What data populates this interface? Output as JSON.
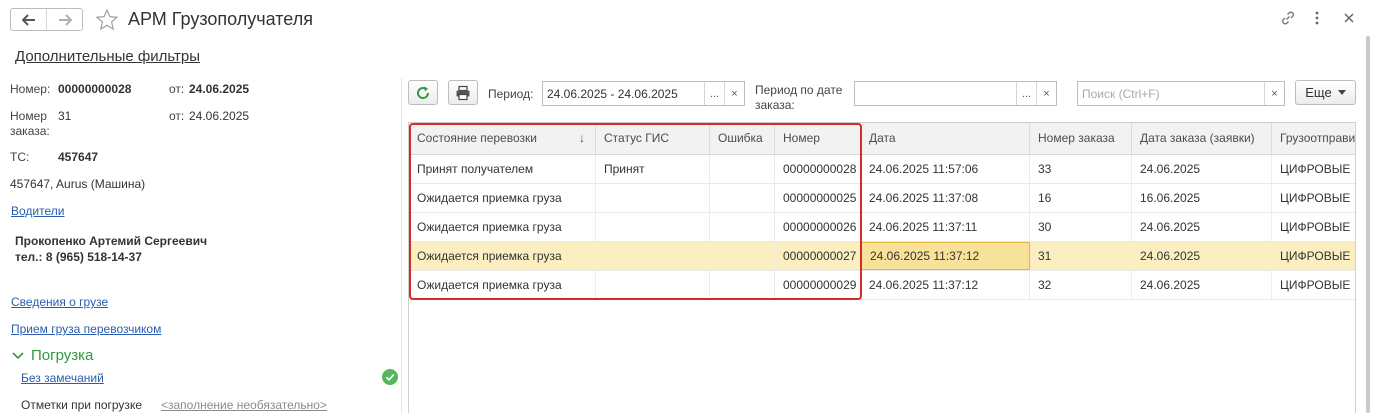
{
  "window": {
    "title": "АРМ Грузополучателя",
    "back_icon": "arrow-left-icon",
    "forward_icon": "arrow-right-icon",
    "favorite_icon": "star-icon",
    "link_icon": "link-icon",
    "menu_icon": "more-vertical-icon",
    "close_icon": "close-icon"
  },
  "filters_link": "Дополнительные фильтры",
  "details": {
    "number_label": "Номер:",
    "number_value": "00000000028",
    "number_date_label": "от:",
    "number_date_value": "24.06.2025",
    "order_label_1": "Номер",
    "order_label_2": "заказа:",
    "order_value": "31",
    "order_date_label": "от:",
    "order_date_value": "24.06.2025",
    "vehicle_label": "ТС:",
    "vehicle_value": "457647",
    "vehicle_desc": "457647, Aurus (Машина)",
    "drivers_link": "Водители",
    "driver_name": "Прокопенко Артемий Сергеевич",
    "driver_phone": "тел.: 8 (965) 518-14-37",
    "cargo_info_link": "Сведения о грузе",
    "carrier_accept_link": "Прием груза перевозчиком",
    "loading_section": "Погрузка",
    "no_remarks_link": "Без замечаний",
    "loading_notes_label": "Отметки при погрузке",
    "loading_notes_placeholder": "<заполнение необязательно>"
  },
  "toolbar": {
    "refresh_icon": "refresh-icon",
    "print_icon": "printer-icon",
    "period_label": "Период:",
    "period_value": "24.06.2025 - 24.06.2025",
    "order_period_label_1": "Период по дате",
    "order_period_label_2": "заказа:",
    "order_period_value": "",
    "ellipsis": "...",
    "clear": "×",
    "search_placeholder": "Поиск (Ctrl+F)",
    "more_label": "Еще"
  },
  "table": {
    "columns": [
      "Состояние перевозки",
      "Статус ГИС",
      "Ошибка",
      "Номер",
      "Дата",
      "Номер заказа",
      "Дата заказа (заявки)",
      "Грузоотправитель"
    ],
    "sort_indicator": "↓",
    "rows": [
      [
        "Принят получателем",
        "Принят",
        "",
        "00000000028",
        "24.06.2025 11:57:06",
        "33",
        "24.06.2025",
        "ЦИФРОВЫЕ"
      ],
      [
        "Ожидается приемка груза",
        "",
        "",
        "00000000025",
        "24.06.2025 11:37:08",
        "16",
        "16.06.2025",
        "ЦИФРОВЫЕ"
      ],
      [
        "Ожидается приемка груза",
        "",
        "",
        "00000000026",
        "24.06.2025 11:37:11",
        "30",
        "24.06.2025",
        "ЦИФРОВЫЕ"
      ],
      [
        "Ожидается приемка груза",
        "",
        "",
        "00000000027",
        "24.06.2025 11:37:12",
        "31",
        "24.06.2025",
        "ЦИФРОВЫЕ"
      ],
      [
        "Ожидается приемка груза",
        "",
        "",
        "00000000029",
        "24.06.2025 11:37:12",
        "32",
        "24.06.2025",
        "ЦИФРОВЫЕ"
      ]
    ],
    "selected_row": 3
  },
  "colors": {
    "accent_green": "#2e9b3e",
    "link_blue": "#2a5db0",
    "highlight_red": "#d62b2b",
    "selected_row": "#fbeec0"
  }
}
